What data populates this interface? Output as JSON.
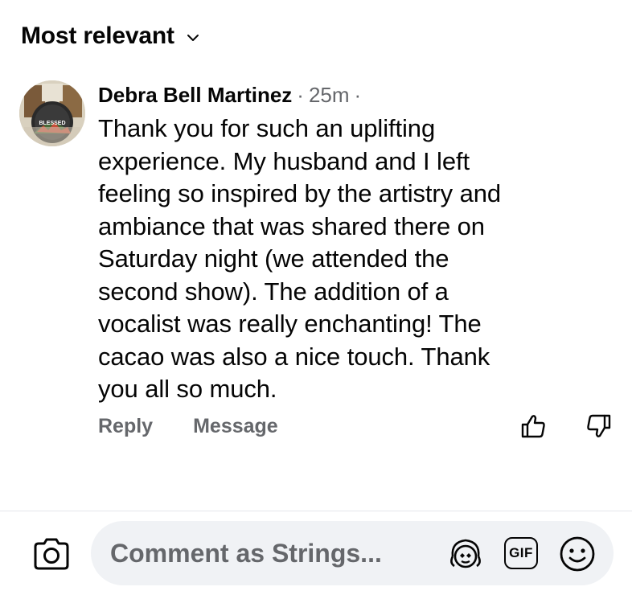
{
  "sort": {
    "label": "Most relevant",
    "icon": "chevron-down-icon"
  },
  "comment": {
    "author": "Debra Bell Martinez",
    "separator_1": "·",
    "timestamp": "25m",
    "separator_2": "·",
    "avatar_badge": "BLESSED",
    "lines": [
      "Thank you for such an uplifting",
      "experience. My husband and I left",
      "feeling so inspired by the artistry and",
      "ambiance that was shared there on",
      "Saturday night (we attended the",
      "second show). The addition of a",
      "vocalist was really enchanting! The",
      "cacao was also a nice touch. Thank",
      "you all so much."
    ],
    "actions": {
      "reply": "Reply",
      "message": "Message"
    },
    "reactions": {
      "like_icon": "thumbs-up-icon",
      "dislike_icon": "thumbs-down-icon"
    }
  },
  "composer": {
    "placeholder": "Comment as Strings...",
    "icons": [
      "camera-icon",
      "avatar-sticker-icon",
      "gif-icon",
      "emoji-icon"
    ],
    "gif_label": "GIF"
  },
  "colors": {
    "text": "#050505",
    "secondary": "#65676b",
    "pill": "#f0f2f5",
    "divider": "#e4e6eb"
  }
}
